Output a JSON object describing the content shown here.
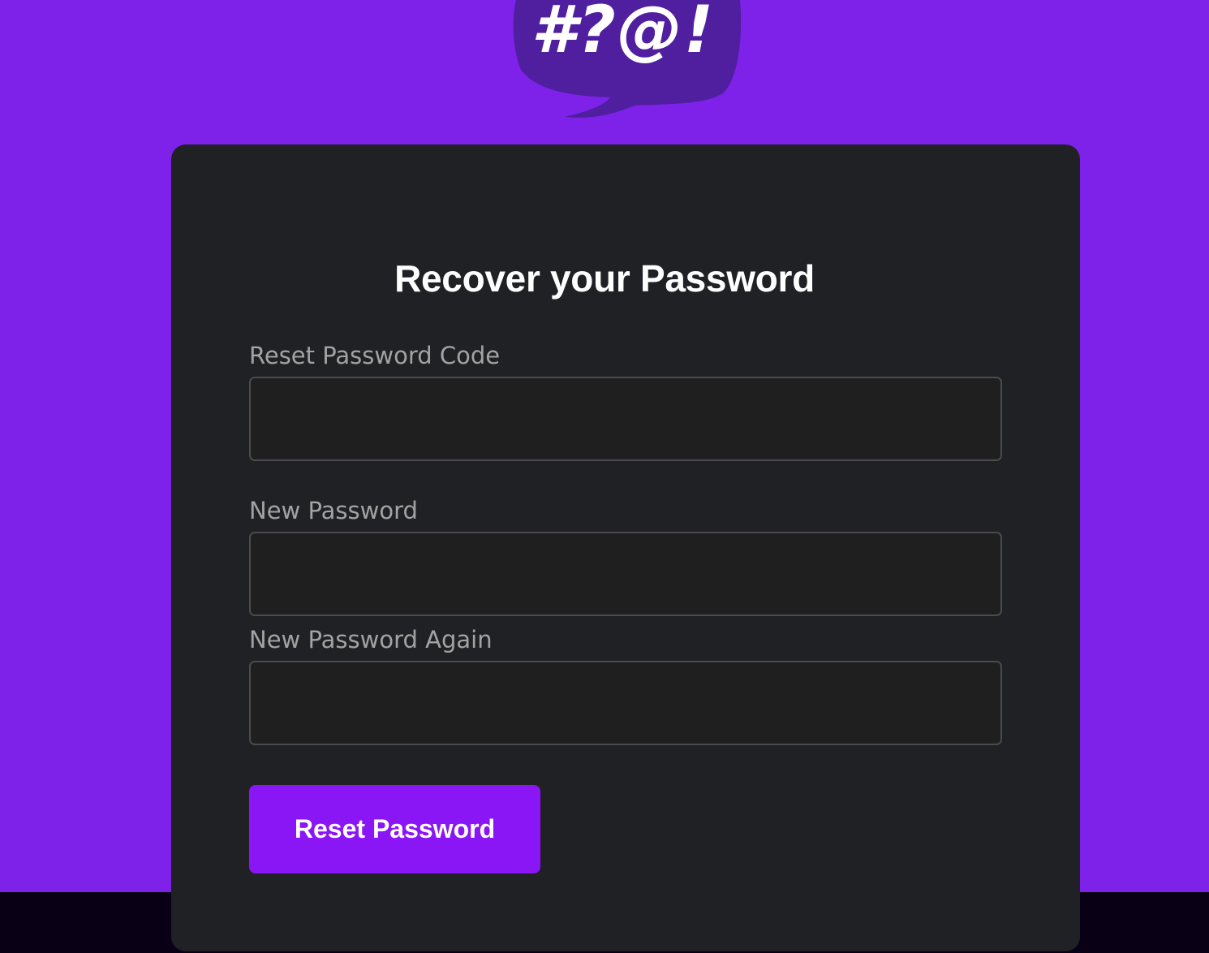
{
  "brand": {
    "logo_text": "#?@!",
    "logo_icon": "speech-bubble-icon",
    "bubble_color": "#4f1fa0"
  },
  "colors": {
    "background": "#7e22ea",
    "card": "#202124",
    "footer": "#0a0015",
    "button": "#8b16f5"
  },
  "form": {
    "title": "Recover your Password",
    "fields": [
      {
        "label": "Reset Password Code",
        "value": "",
        "placeholder": ""
      },
      {
        "label": "New Password",
        "value": "",
        "placeholder": ""
      },
      {
        "label": "New Password Again",
        "value": "",
        "placeholder": ""
      }
    ],
    "submit_label": "Reset Password"
  }
}
